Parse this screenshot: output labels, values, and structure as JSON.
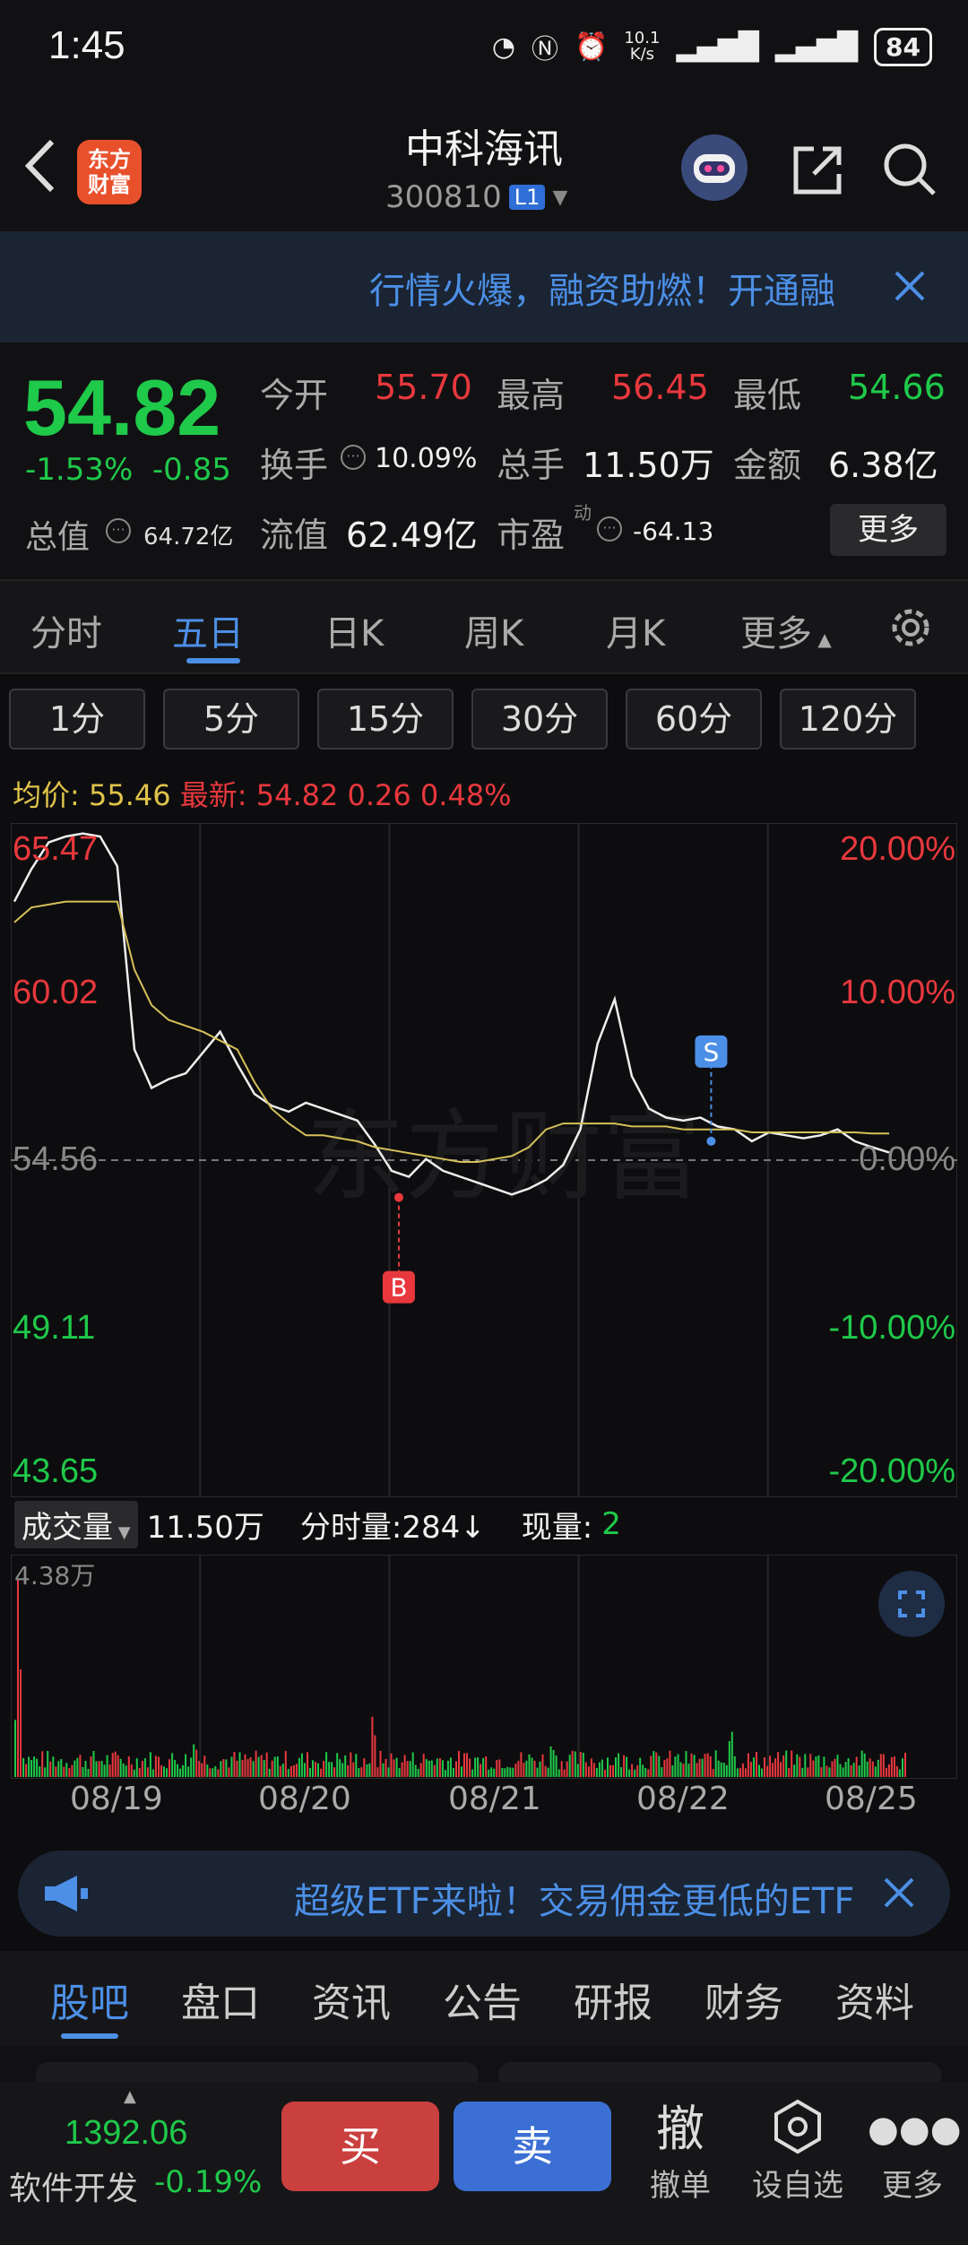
{
  "status_bar": {
    "time": "1:45",
    "net_speed": "10.1",
    "net_unit": "K/s",
    "battery": "84"
  },
  "header": {
    "title": "中科海讯",
    "code": "300810",
    "level_badge": "L1",
    "logo_text_1": "东方",
    "logo_text_2": "财富"
  },
  "banner": {
    "text": "行情火爆，融资助燃！开通融"
  },
  "quote": {
    "price": "54.82",
    "change_pct": "-1.53%",
    "change_amt": "-0.85",
    "open_label": "今开",
    "open": "55.70",
    "high_label": "最高",
    "high": "56.45",
    "low_label": "最低",
    "low": "54.66",
    "turnover_label": "换手",
    "turnover": "10.09%",
    "volume_label": "总手",
    "volume": "11.50万",
    "amount_label": "金额",
    "amount": "6.38亿",
    "total_value_label": "总值",
    "total_value": "64.72亿",
    "float_value_label": "流值",
    "float_value": "62.49亿",
    "pe_label": "市盈",
    "pe_sup": "动",
    "pe": "-64.13",
    "more_label": "更多"
  },
  "period_tabs": [
    "分时",
    "五日",
    "日K",
    "周K",
    "月K",
    "更多"
  ],
  "active_period": "五日",
  "minute_buttons": [
    "1分",
    "5分",
    "15分",
    "30分",
    "60分",
    "120分"
  ],
  "info_line": {
    "avg_label": "均价:",
    "avg": "55.46",
    "latest_label": "最新:",
    "latest": "54.82",
    "diff": "0.26",
    "diff_pct": "0.48%"
  },
  "chart_data": {
    "type": "line",
    "title": "",
    "left_axis_labels": [
      "65.47",
      "60.02",
      "54.56",
      "49.11",
      "43.65"
    ],
    "right_axis_labels": [
      "20.00%",
      "10.00%",
      "0.00%",
      "-10.00%",
      "-20.00%"
    ],
    "ylim": [
      43.65,
      65.47
    ],
    "prev_close": 54.56,
    "days": [
      "08/19",
      "08/20",
      "08/21",
      "08/22",
      "08/25"
    ],
    "markers": [
      {
        "label": "B",
        "day": "08/21",
        "price": 53.3
      },
      {
        "label": "S",
        "day": "08/22",
        "price": 55.2
      }
    ],
    "series": [
      {
        "name": "价格",
        "color": "#eeeeee",
        "values": [
          63.3,
          64.4,
          65.3,
          65.5,
          65.6,
          65.5,
          64.5,
          58.3,
          57.0,
          57.3,
          57.5,
          58.2,
          58.9,
          57.8,
          56.8,
          56.4,
          56.2,
          56.5,
          56.3,
          56.1,
          55.9,
          55.1,
          54.2,
          54.0,
          54.6,
          54.2,
          54.0,
          53.8,
          53.6,
          53.4,
          53.6,
          53.9,
          54.4,
          55.6,
          58.5,
          60.0,
          57.4,
          56.3,
          56.0,
          55.9,
          56.0,
          55.7,
          55.6,
          55.2,
          55.5,
          55.4,
          55.3,
          55.4,
          55.6,
          55.2,
          55.0,
          54.82
        ]
      },
      {
        "name": "均价",
        "color": "#d6c05a",
        "values": [
          62.6,
          63.1,
          63.2,
          63.3,
          63.3,
          63.3,
          63.3,
          61.0,
          59.8,
          59.3,
          59.1,
          58.9,
          58.6,
          58.3,
          57.2,
          56.3,
          55.8,
          55.4,
          55.4,
          55.3,
          55.2,
          55.0,
          54.9,
          54.8,
          54.7,
          54.6,
          54.5,
          54.5,
          54.6,
          54.7,
          55.0,
          55.6,
          55.8,
          55.8,
          55.8,
          55.8,
          55.7,
          55.7,
          55.7,
          55.6,
          55.6,
          55.6,
          55.6,
          55.5,
          55.5,
          55.5,
          55.5,
          55.5,
          55.5,
          55.5,
          55.46,
          55.46
        ]
      }
    ]
  },
  "volume_bar": {
    "selector": "成交量",
    "total": "11.50万",
    "tick_label": "分时量:284↓",
    "now_label": "现量:",
    "now_value": "2",
    "max_label": "4.38万"
  },
  "ad": {
    "text": "超级ETF来啦！交易佣金更低的ETF"
  },
  "bottom_tabs": [
    "股吧",
    "盘口",
    "资讯",
    "公告",
    "研报",
    "财务",
    "资料"
  ],
  "active_bottom_tab": "股吧",
  "footer": {
    "index_value": "1392.06",
    "index_name": "软件开发",
    "index_change": "-0.19%",
    "buy": "买",
    "sell": "卖",
    "cancel_icon": "撤",
    "cancel_label": "撤单",
    "watch_label": "设自选",
    "more_label": "更多"
  }
}
